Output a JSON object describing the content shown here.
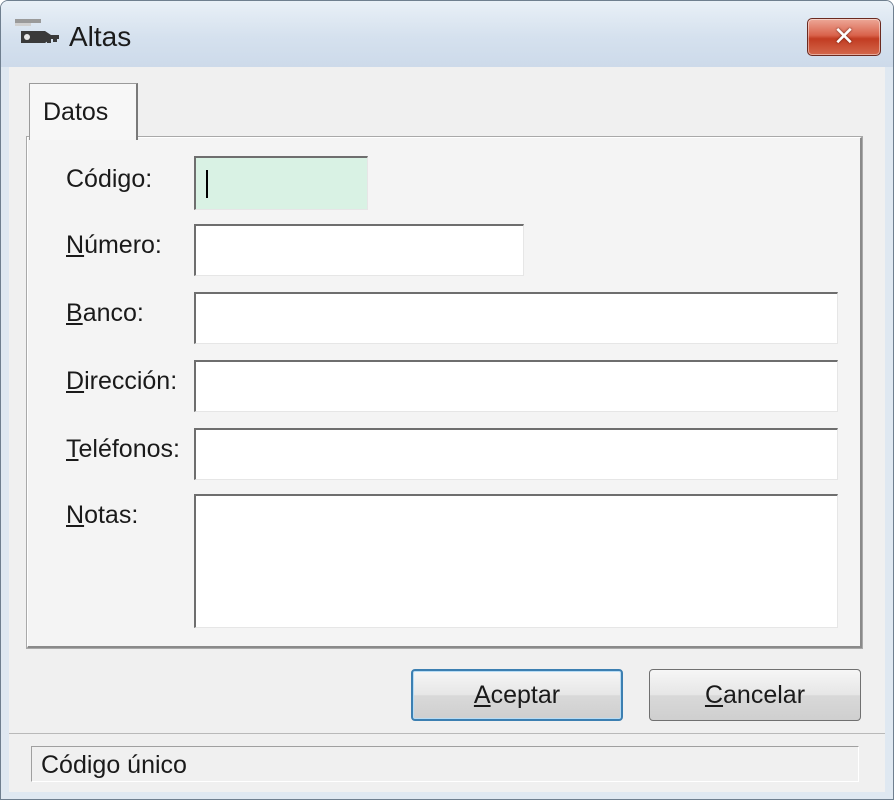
{
  "window": {
    "title": "Altas",
    "close_label": "✕"
  },
  "tabs": [
    {
      "label": "Datos",
      "selected": true
    }
  ],
  "form": {
    "codigo": {
      "label": "Código:",
      "value": ""
    },
    "numero": {
      "label_ul": "N",
      "label_rest": "úmero:",
      "value": ""
    },
    "banco": {
      "label_ul": "B",
      "label_rest": "anco:",
      "value": ""
    },
    "direccion": {
      "label_ul": "D",
      "label_rest": "irección:",
      "value": ""
    },
    "telefonos": {
      "label_ul": "T",
      "label_rest": "eléfonos:",
      "value": ""
    },
    "notas": {
      "label_ul": "N",
      "label_rest": "otas:",
      "value": ""
    }
  },
  "buttons": {
    "accept": {
      "ul": "A",
      "rest": "ceptar"
    },
    "cancel": {
      "ul": "C",
      "rest": "ancelar"
    }
  },
  "status": {
    "text": "Código único"
  },
  "icons": {
    "app": "key-icon",
    "close": "close-icon"
  },
  "colors": {
    "focused_field": "#d9f2e4",
    "close_button": "#c23c22",
    "default_button_border": "#3c7fb1"
  }
}
